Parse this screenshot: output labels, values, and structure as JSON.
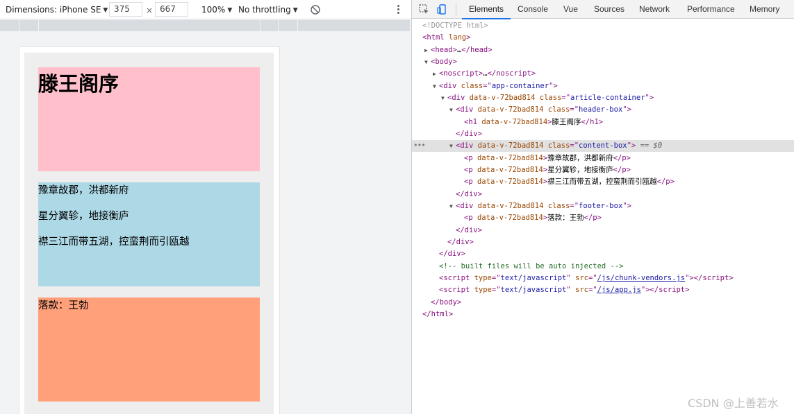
{
  "device_toolbar": {
    "dimensions_label": "Dimensions: iPhone SE",
    "width_value": "375",
    "times": "×",
    "height_value": "667",
    "zoom": "100%",
    "throttling": "No throttling"
  },
  "page": {
    "title": "滕王阁序",
    "paragraphs": [
      "豫章故郡，洪都新府",
      "星分翼轸，地接衡庐",
      "襟三江而带五湖，控蛮荆而引瓯越"
    ],
    "footer": "落款：王勃"
  },
  "devtools": {
    "tabs": [
      "Elements",
      "Console",
      "Vue",
      "Sources",
      "Network",
      "Performance",
      "Memory"
    ],
    "active_tab": "Elements",
    "dom": {
      "doctype": "<!DOCTYPE html>",
      "html_open": "html",
      "html_attr": "lang",
      "head": "head",
      "ellipsis": "…",
      "body": "body",
      "noscript": "noscript",
      "div": "div",
      "h1": "h1",
      "p": "p",
      "script": "script",
      "class": "class",
      "data_v": "data-v-72bad814",
      "app_container": "app-container",
      "article_container": "article-container",
      "header_box": "header-box",
      "content_box": "content-box",
      "footer_box": "footer-box",
      "selected_marker": "== $0",
      "comment": "<!-- built files will be auto injected -->",
      "type_attr": "type",
      "type_val": "text/javascript",
      "src_attr": "src",
      "src1": "/js/chunk-vendors.js",
      "src2": "/js/app.js"
    }
  },
  "watermark": "CSDN @上善若水",
  "colors": {
    "header_box": "#ffc0cb",
    "content_box": "#add8e6",
    "footer_box": "#ffa07a",
    "tab_underline": "#1a73e8"
  },
  "icons": [
    "chevron-down-icon",
    "rotate-icon",
    "more-vert-icon",
    "inspect-cursor-icon",
    "device-toggle-icon",
    "expand-triangle-icon",
    "collapse-triangle-icon"
  ]
}
